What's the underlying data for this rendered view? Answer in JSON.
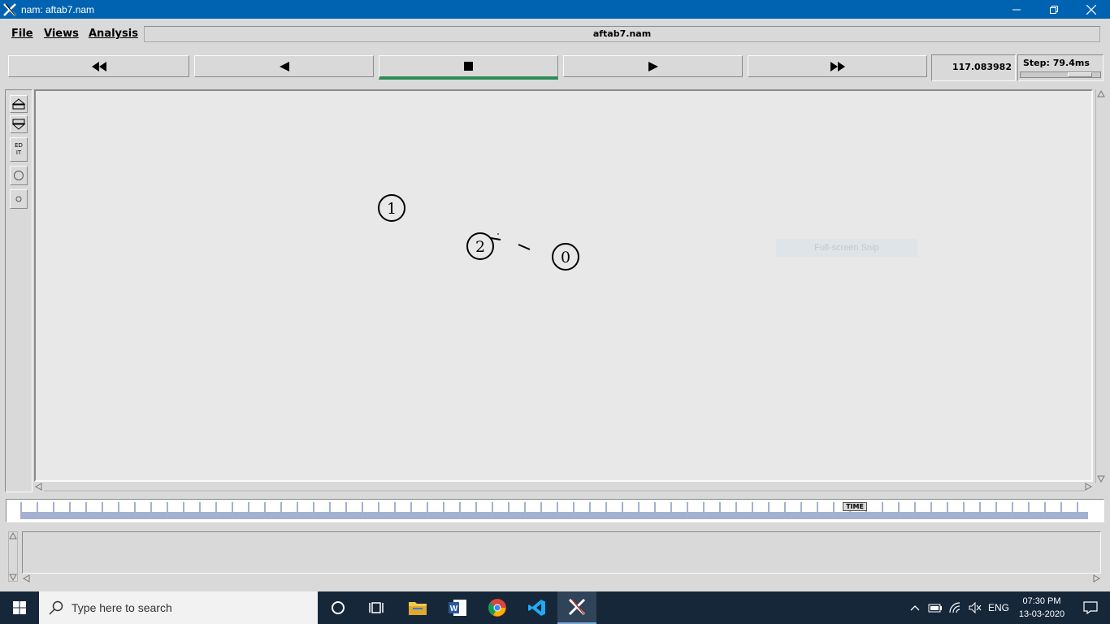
{
  "window": {
    "title": "nam: aftab7.nam",
    "controls": [
      "minimize",
      "restore",
      "close"
    ]
  },
  "menu": {
    "items": [
      {
        "label": "File"
      },
      {
        "label": "Views"
      },
      {
        "label": "Analysis"
      }
    ],
    "filename": "aftab7.nam"
  },
  "playback": {
    "buttons": [
      {
        "name": "fast-rewind",
        "icon": "fast-rewind-icon"
      },
      {
        "name": "rewind",
        "icon": "play-backward-icon"
      },
      {
        "name": "stop",
        "icon": "stop-icon",
        "active": true
      },
      {
        "name": "play",
        "icon": "play-icon"
      },
      {
        "name": "fast-forward",
        "icon": "fast-forward-icon"
      }
    ],
    "time": "117.083982",
    "step": "Step: 79.4ms"
  },
  "tools": [
    {
      "name": "zoom-in",
      "icon": "zoom-in-icon"
    },
    {
      "name": "zoom-out",
      "icon": "zoom-out-icon"
    },
    {
      "name": "edit",
      "label": "ED IT"
    },
    {
      "name": "node-large",
      "icon": "circle-icon"
    },
    {
      "name": "node-small",
      "icon": "small-circle-icon"
    }
  ],
  "network": {
    "nodes": [
      {
        "id": "1",
        "label": "1"
      },
      {
        "id": "2",
        "label": "2"
      },
      {
        "id": "0",
        "label": "0"
      }
    ]
  },
  "timeline": {
    "label": "TIME"
  },
  "overlay": {
    "snip_hint": "Full-screen Snip"
  },
  "taskbar": {
    "search_placeholder": "Type here to search",
    "language": "ENG",
    "time": "07:30 PM",
    "date": "13-03-2020",
    "apps": [
      "file-explorer",
      "word",
      "chrome",
      "vscode",
      "nam"
    ]
  },
  "colors": {
    "titlebar": "#0063b1",
    "taskbar": "#16273a",
    "active_play": "#2e8b57",
    "timeline_ticks": "#1a3b8a",
    "canvas_bg": "#e8e8e8"
  }
}
